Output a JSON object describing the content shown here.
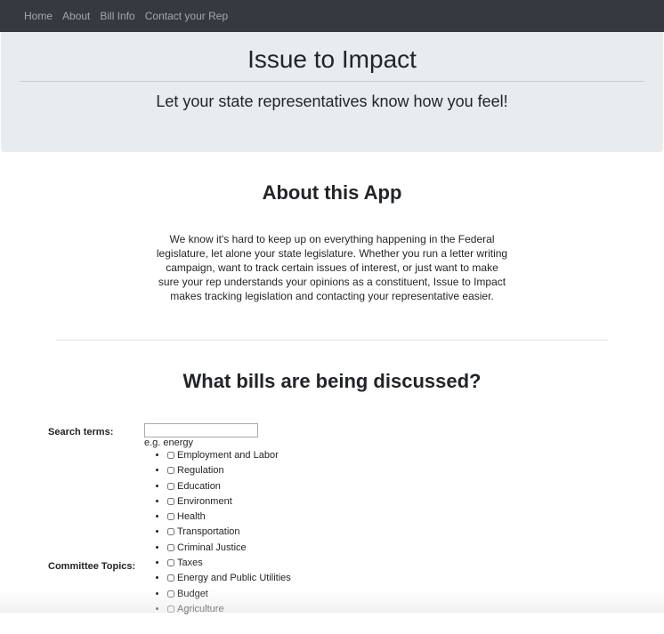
{
  "nav": {
    "items": [
      "Home",
      "About",
      "Bill Info",
      "Contact your Rep"
    ]
  },
  "header": {
    "title": "Issue to Impact",
    "tagline": "Let your state representatives know how you feel!"
  },
  "about": {
    "title": "About this App",
    "text": "We know it's hard to keep up on everything happening in the Federal legislature, let alone your state legislature. Whether you run a letter writing campaign, want to track certain issues of interest, or just want to make sure your rep understands your opinions as a constituent, Issue to Impact makes tracking legislation and contacting your representative easier."
  },
  "bills": {
    "title": "What bills are being discussed?",
    "search_label": "Search terms:",
    "search_value": "",
    "search_hint": "e.g. energy",
    "committee_label": "Committee Topics:",
    "topics": [
      "Employment and Labor",
      "Regulation",
      "Education",
      "Environment",
      "Health",
      "Transportation",
      "Criminal Justice",
      "Taxes",
      "Energy and Public Utilities",
      "Budget",
      "Agriculture"
    ]
  }
}
